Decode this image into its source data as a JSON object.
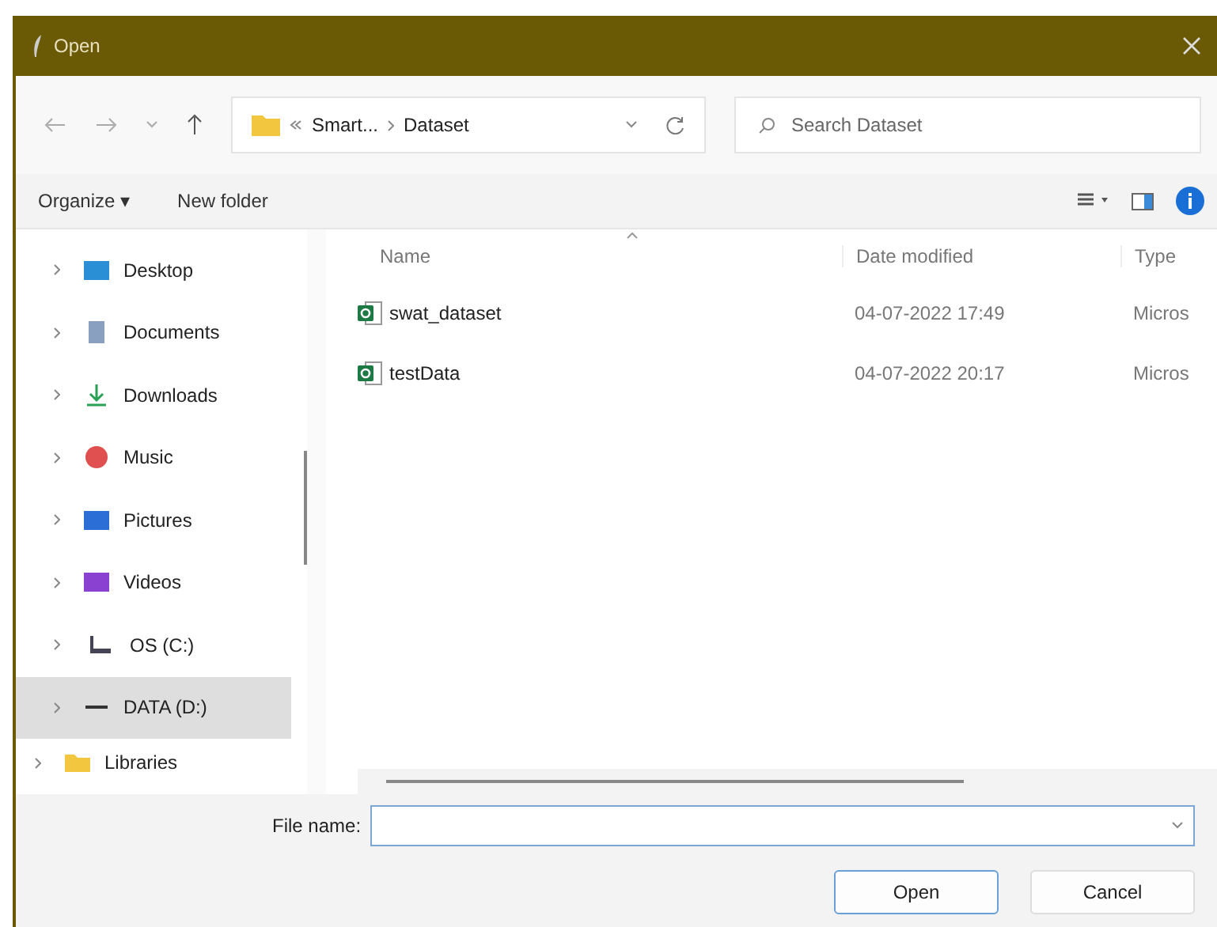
{
  "window": {
    "title": "Open"
  },
  "address": {
    "path": [
      "Smart...",
      "Dataset"
    ]
  },
  "search": {
    "placeholder": "Search Dataset"
  },
  "toolbar": {
    "organize": "Organize ▾",
    "new_folder": "New folder"
  },
  "sidebar": {
    "items": [
      {
        "label": "Desktop",
        "kind": "desktop",
        "selected": false
      },
      {
        "label": "Documents",
        "kind": "documents",
        "selected": false
      },
      {
        "label": "Downloads",
        "kind": "downloads",
        "selected": false
      },
      {
        "label": "Music",
        "kind": "music",
        "selected": false
      },
      {
        "label": "Pictures",
        "kind": "pictures",
        "selected": false
      },
      {
        "label": "Videos",
        "kind": "videos",
        "selected": false
      },
      {
        "label": "OS (C:)",
        "kind": "os-drive",
        "selected": false
      },
      {
        "label": "DATA (D:)",
        "kind": "drive",
        "selected": true
      },
      {
        "label": "Libraries",
        "kind": "folder",
        "selected": false
      }
    ]
  },
  "table": {
    "columns": [
      "Name",
      "Date modified",
      "Type"
    ],
    "rows": [
      {
        "name": "swat_dataset",
        "date": "04-07-2022 17:49",
        "type": "Micros"
      },
      {
        "name": "testData",
        "date": "04-07-2022 20:17",
        "type": "Micros"
      }
    ]
  },
  "file_name": {
    "label": "File name:"
  },
  "buttons": [
    "Open",
    "Cancel"
  ]
}
